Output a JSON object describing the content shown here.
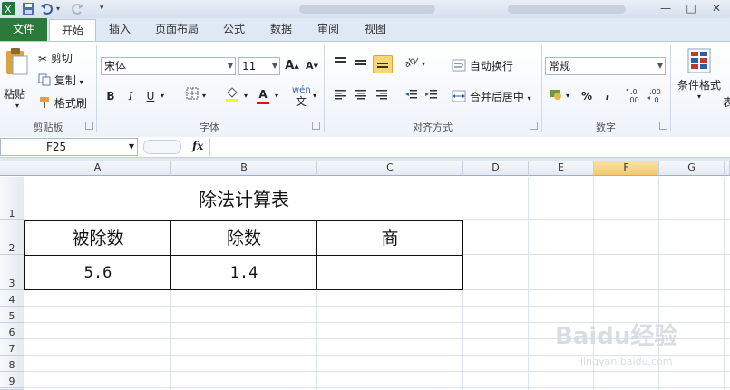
{
  "tabs": {
    "file": "文件",
    "items": [
      "开始",
      "插入",
      "页面布局",
      "公式",
      "数据",
      "审阅",
      "视图"
    ]
  },
  "clipboard": {
    "paste": "粘贴",
    "cut": "剪切",
    "copy": "复制",
    "format_painter": "格式刷",
    "label": "剪贴板"
  },
  "font": {
    "name": "宋体",
    "size": "11",
    "grow": "A",
    "shrink": "A",
    "bold": "B",
    "italic": "I",
    "underline": "U",
    "color_a": "A",
    "phonetic": "wén",
    "label": "字体"
  },
  "alignment": {
    "wrap_text": "自动换行",
    "merge_center": "合并后居中",
    "label": "对齐方式"
  },
  "number": {
    "format": "常规",
    "percent": "%",
    "comma": ",",
    "label": "数字"
  },
  "styles": {
    "conditional_format": "条件格式",
    "table_partial": "表"
  },
  "formula_bar": {
    "name_box": "F25",
    "fx": "fx",
    "value": ""
  },
  "columns": [
    "A",
    "B",
    "C",
    "D",
    "E",
    "F",
    "G"
  ],
  "selected_column": "F",
  "rows": [
    "1",
    "2",
    "3",
    "4",
    "5",
    "6",
    "7",
    "8",
    "9"
  ],
  "sheet": {
    "title": "除法计算表",
    "headers": [
      "被除数",
      "除数",
      "商"
    ],
    "values": [
      "5.6",
      "1.4",
      ""
    ]
  },
  "watermark": {
    "brand": "Baidu经验",
    "url": "jingyan.baidu.com"
  },
  "colors": {
    "file_tab": "#2a7a3a",
    "selected_header": "#f4c96b",
    "ribbon_bg": "#eef3fa"
  }
}
